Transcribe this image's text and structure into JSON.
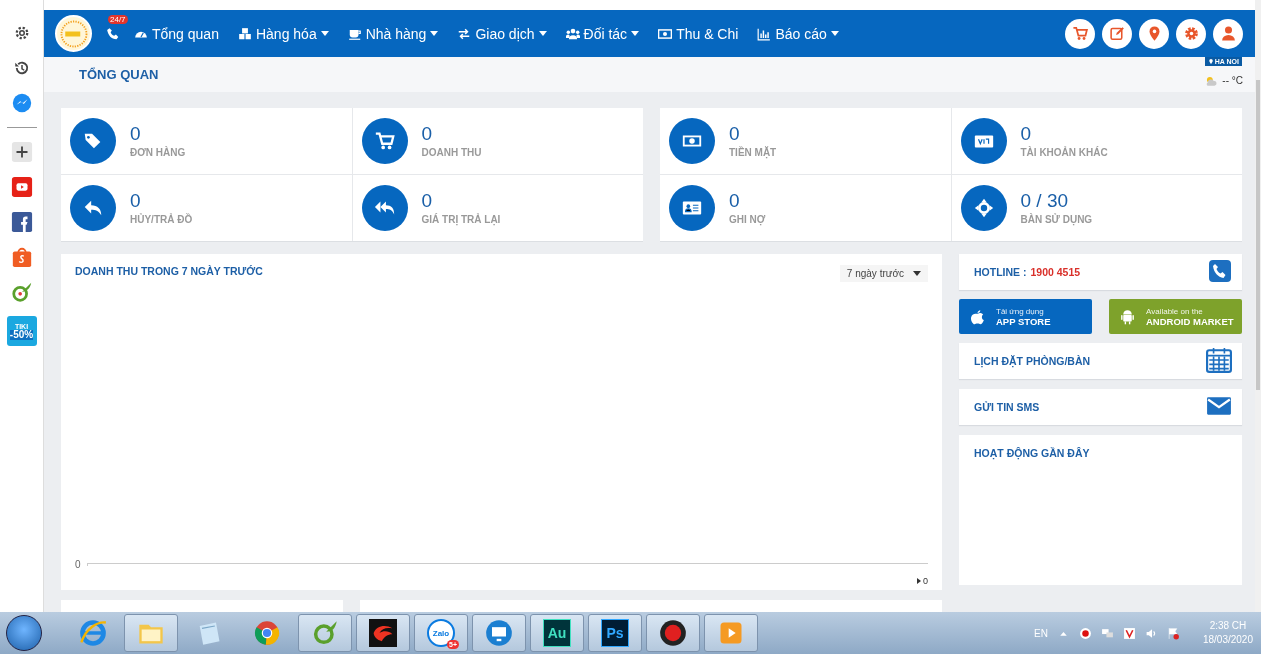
{
  "side_panel": {
    "items": [
      {
        "kind": "settings"
      },
      {
        "kind": "history"
      },
      {
        "kind": "messenger"
      },
      {
        "kind": "divider"
      },
      {
        "kind": "add"
      },
      {
        "kind": "youtube"
      },
      {
        "kind": "facebook"
      },
      {
        "kind": "shopee"
      },
      {
        "kind": "leaf"
      },
      {
        "kind": "tiki",
        "label": "TIKI",
        "badge": "-50%"
      }
    ]
  },
  "navbar": {
    "hotline_badge": "24/7",
    "menu": [
      {
        "label": "Tổng quan",
        "has_menu": false
      },
      {
        "label": "Hàng hóa",
        "has_menu": true
      },
      {
        "label": "Nhà hàng",
        "has_menu": true
      },
      {
        "label": "Giao dịch",
        "has_menu": true
      },
      {
        "label": "Đối tác",
        "has_menu": true
      },
      {
        "label": "Thu & Chi",
        "has_menu": false
      },
      {
        "label": "Báo cáo",
        "has_menu": true
      }
    ]
  },
  "page_header": {
    "title": "TỔNG QUAN",
    "location": "HA NOI",
    "temperature": "-- °C"
  },
  "stats": [
    [
      {
        "value": "0",
        "label": "ĐƠN HÀNG"
      },
      {
        "value": "0",
        "label": "DOANH THU"
      },
      {
        "value": "0",
        "label": "HỦY/TRẢ ĐỒ"
      },
      {
        "value": "0",
        "label": "GIÁ TRỊ TRẢ LẠI"
      }
    ],
    [
      {
        "value": "0",
        "label": "TIỀN MẶT"
      },
      {
        "value": "0",
        "label": "TÀI KHOẢN KHÁC"
      },
      {
        "value": "0",
        "label": "GHI NỢ"
      },
      {
        "value": "0 / 30",
        "label": "BÀN SỬ DỤNG"
      }
    ]
  ],
  "revenue_panel": {
    "title": "DOANH THU TRONG 7 NGÀY TRƯỚC",
    "period": "7 ngày trước",
    "y_label": "0",
    "legend": "0"
  },
  "right_column": {
    "hotline_label": "HOTLINE :",
    "hotline_number": "1900 4515",
    "app_buttons": [
      {
        "kind": "ios",
        "small": "Tải ứng dụng",
        "big": "APP STORE"
      },
      {
        "kind": "android",
        "small": "Available on the",
        "big": "ANDROID MARKET"
      }
    ],
    "links": [
      {
        "kind": "calendar",
        "label": "LỊCH ĐẶT PHÒNG/BÀN"
      },
      {
        "kind": "sms",
        "label": "GỬI TIN SMS"
      }
    ],
    "activity_title": "HOẠT ĐỘNG GẦN ĐÂY"
  },
  "taskbar": {
    "apps": [
      {
        "kind": "ie",
        "open": false
      },
      {
        "kind": "folder",
        "open": true
      },
      {
        "kind": "notepad",
        "open": false
      },
      {
        "kind": "chrome",
        "open": false
      },
      {
        "kind": "coccoc",
        "open": true
      },
      {
        "kind": "garena",
        "open": true
      },
      {
        "kind": "zalo",
        "open": true,
        "label": "Zalo",
        "badge": "5+"
      },
      {
        "kind": "remote",
        "open": true
      },
      {
        "kind": "au",
        "open": true,
        "label": "Au"
      },
      {
        "kind": "ps",
        "open": true,
        "label": "Ps"
      },
      {
        "kind": "record",
        "open": true
      },
      {
        "kind": "media",
        "open": true
      }
    ],
    "language": "EN",
    "time": "2:38 CH",
    "date": "18/03/2020"
  }
}
